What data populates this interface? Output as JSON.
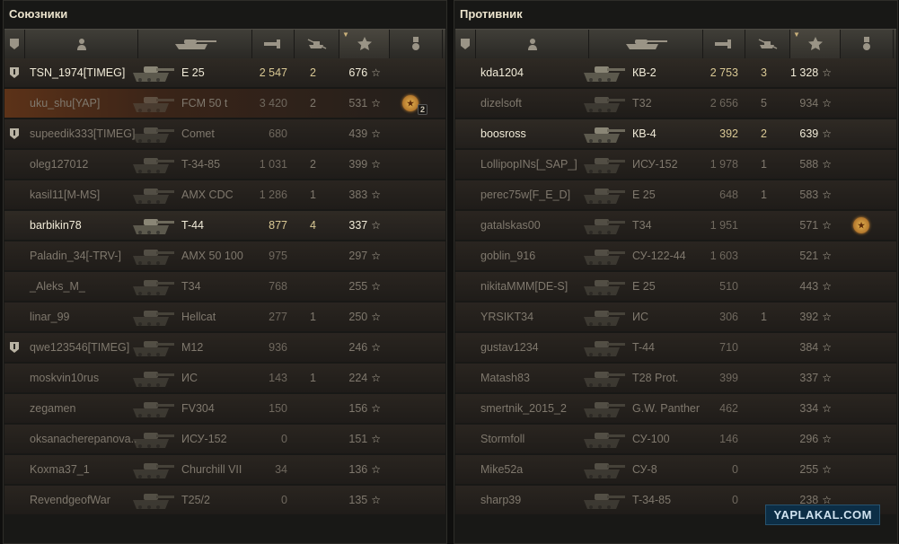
{
  "allies": {
    "title": "Союзники",
    "rows": [
      {
        "platoon": true,
        "alive": true,
        "hl": false,
        "player": "TSN_1974[TIMEG]",
        "tank": "E 25",
        "damage": "2 547",
        "kills": "2",
        "xp": "676",
        "medal": ""
      },
      {
        "platoon": false,
        "alive": false,
        "hl": true,
        "player": "uku_shu[YAP]",
        "tank": "FCM 50 t",
        "damage": "3 420",
        "kills": "2",
        "xp": "531",
        "medal": "2"
      },
      {
        "platoon": true,
        "alive": false,
        "hl": false,
        "player": "supeedik333[TIMEG]",
        "tank": "Comet",
        "damage": "680",
        "kills": "",
        "xp": "439",
        "medal": ""
      },
      {
        "platoon": false,
        "alive": false,
        "hl": false,
        "player": "oleg127012",
        "tank": "T-34-85",
        "damage": "1 031",
        "kills": "2",
        "xp": "399",
        "medal": ""
      },
      {
        "platoon": false,
        "alive": false,
        "hl": false,
        "player": "kasil11[M-MS]",
        "tank": "AMX CDC",
        "damage": "1 286",
        "kills": "1",
        "xp": "383",
        "medal": ""
      },
      {
        "platoon": false,
        "alive": true,
        "hl": false,
        "player": "barbikin78",
        "tank": "T-44",
        "damage": "877",
        "kills": "4",
        "xp": "337",
        "medal": ""
      },
      {
        "platoon": false,
        "alive": false,
        "hl": false,
        "player": "Paladin_34[-TRV-]",
        "tank": "AMX 50 100",
        "damage": "975",
        "kills": "",
        "xp": "297",
        "medal": ""
      },
      {
        "platoon": false,
        "alive": false,
        "hl": false,
        "player": "_Aleks_M_",
        "tank": "T34",
        "damage": "768",
        "kills": "",
        "xp": "255",
        "medal": ""
      },
      {
        "platoon": false,
        "alive": false,
        "hl": false,
        "player": "linar_99",
        "tank": "Hellcat",
        "damage": "277",
        "kills": "1",
        "xp": "250",
        "medal": ""
      },
      {
        "platoon": true,
        "alive": false,
        "hl": false,
        "player": "qwe123546[TIMEG]",
        "tank": "M12",
        "damage": "936",
        "kills": "",
        "xp": "246",
        "medal": ""
      },
      {
        "platoon": false,
        "alive": false,
        "hl": false,
        "player": "moskvin10rus",
        "tank": "ИС",
        "damage": "143",
        "kills": "1",
        "xp": "224",
        "medal": ""
      },
      {
        "platoon": false,
        "alive": false,
        "hl": false,
        "player": "zegamen",
        "tank": "FV304",
        "damage": "150",
        "kills": "",
        "xp": "156",
        "medal": ""
      },
      {
        "platoon": false,
        "alive": false,
        "hl": false,
        "player": "oksanacherepanova..",
        "tank": "ИСУ-152",
        "damage": "0",
        "kills": "",
        "xp": "151",
        "medal": ""
      },
      {
        "platoon": false,
        "alive": false,
        "hl": false,
        "player": "Koxma37_1",
        "tank": "Churchill VII",
        "damage": "34",
        "kills": "",
        "xp": "136",
        "medal": ""
      },
      {
        "platoon": false,
        "alive": false,
        "hl": false,
        "player": "RevendgeofWar",
        "tank": "T25/2",
        "damage": "0",
        "kills": "",
        "xp": "135",
        "medal": ""
      }
    ]
  },
  "enemies": {
    "title": "Противник",
    "rows": [
      {
        "platoon": false,
        "alive": true,
        "hl": false,
        "player": "kda1204",
        "tank": "КВ-2",
        "damage": "2 753",
        "kills": "3",
        "xp": "1 328",
        "medal": ""
      },
      {
        "platoon": false,
        "alive": false,
        "hl": false,
        "player": "dizelsoft",
        "tank": "T32",
        "damage": "2 656",
        "kills": "5",
        "xp": "934",
        "medal": ""
      },
      {
        "platoon": false,
        "alive": true,
        "hl": false,
        "player": "boosross",
        "tank": "КВ-4",
        "damage": "392",
        "kills": "2",
        "xp": "639",
        "medal": ""
      },
      {
        "platoon": false,
        "alive": false,
        "hl": false,
        "player": "LollipopINs[_SAP_]",
        "tank": "ИСУ-152",
        "damage": "1 978",
        "kills": "1",
        "xp": "588",
        "medal": ""
      },
      {
        "platoon": false,
        "alive": false,
        "hl": false,
        "player": "perec75w[F_E_D]",
        "tank": "E 25",
        "damage": "648",
        "kills": "1",
        "xp": "583",
        "medal": ""
      },
      {
        "platoon": false,
        "alive": false,
        "hl": false,
        "player": "gatalskas00",
        "tank": "T34",
        "damage": "1 951",
        "kills": "",
        "xp": "571",
        "medal": "1"
      },
      {
        "platoon": false,
        "alive": false,
        "hl": false,
        "player": "goblin_916",
        "tank": "СУ-122-44",
        "damage": "1 603",
        "kills": "",
        "xp": "521",
        "medal": ""
      },
      {
        "platoon": false,
        "alive": false,
        "hl": false,
        "player": "nikitaMMM[DE-S]",
        "tank": "E 25",
        "damage": "510",
        "kills": "",
        "xp": "443",
        "medal": ""
      },
      {
        "platoon": false,
        "alive": false,
        "hl": false,
        "player": "YRSIKT34",
        "tank": "ИС",
        "damage": "306",
        "kills": "1",
        "xp": "392",
        "medal": ""
      },
      {
        "platoon": false,
        "alive": false,
        "hl": false,
        "player": "gustav1234",
        "tank": "T-44",
        "damage": "710",
        "kills": "",
        "xp": "384",
        "medal": ""
      },
      {
        "platoon": false,
        "alive": false,
        "hl": false,
        "player": "Matash83",
        "tank": "T28 Prot.",
        "damage": "399",
        "kills": "",
        "xp": "337",
        "medal": ""
      },
      {
        "platoon": false,
        "alive": false,
        "hl": false,
        "player": "smertnik_2015_2",
        "tank": "G.W. Panther",
        "damage": "462",
        "kills": "",
        "xp": "334",
        "medal": ""
      },
      {
        "platoon": false,
        "alive": false,
        "hl": false,
        "player": "Stormfoll",
        "tank": "СУ-100",
        "damage": "146",
        "kills": "",
        "xp": "296",
        "medal": ""
      },
      {
        "platoon": false,
        "alive": false,
        "hl": false,
        "player": "Mike52a",
        "tank": "СУ-8",
        "damage": "0",
        "kills": "",
        "xp": "255",
        "medal": ""
      },
      {
        "platoon": false,
        "alive": false,
        "hl": false,
        "player": "sharp39",
        "tank": "T-34-85",
        "damage": "0",
        "kills": "",
        "xp": "238",
        "medal": ""
      }
    ]
  },
  "columns": [
    "platoon-icon",
    "player-icon",
    "tank-icon",
    "damage-icon",
    "kills-icon",
    "xp-star-icon",
    "medal-icon"
  ],
  "colors": {
    "alive_text": "#f2ecd9",
    "dead_text": "#7f786d",
    "highlight": "#5c3218",
    "damage_gold": "#d9c894"
  },
  "watermark": "YAPLAKAL.COM"
}
